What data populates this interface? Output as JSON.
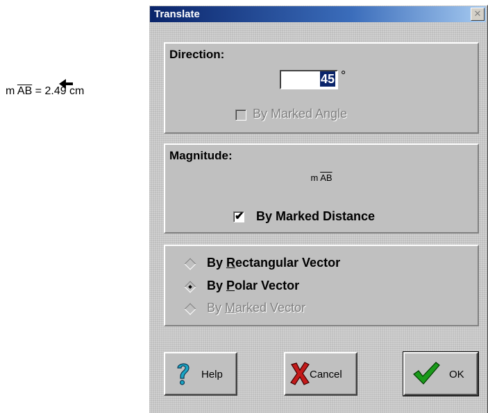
{
  "sketch": {
    "measure_prefix": "m ",
    "measure_segment": "AB",
    "measure_value": " = 2.49 cm"
  },
  "dialog": {
    "title": "Translate",
    "close_glyph": "✕"
  },
  "direction": {
    "label": "Direction:",
    "value": "45",
    "unit": "°",
    "by_marked_angle": {
      "label": "By Marked Angle",
      "checked": false,
      "enabled": false
    }
  },
  "magnitude": {
    "label": "Magnitude:",
    "formula_prefix": "m ",
    "formula_segment": "AB",
    "by_marked_distance": {
      "label": "By Marked Distance",
      "checked": true,
      "enabled": true,
      "mark": "✔"
    }
  },
  "vector_mode": {
    "options": [
      {
        "pre": "By ",
        "key": "R",
        "post": "ectangular Vector",
        "selected": false,
        "enabled": true
      },
      {
        "pre": "By ",
        "key": "P",
        "post": "olar Vector",
        "selected": true,
        "enabled": true
      },
      {
        "pre": "By ",
        "key": "M",
        "post": "arked Vector",
        "selected": false,
        "enabled": false
      }
    ]
  },
  "buttons": {
    "help": {
      "label": "Help",
      "icon": "question-mark-icon",
      "icon_color": "#1aa5c4"
    },
    "cancel": {
      "label": "Cancel",
      "icon": "red-x-icon",
      "icon_color": "#c41a1a"
    },
    "ok": {
      "label": "OK",
      "icon": "green-checkmark-icon",
      "icon_color": "#1a9a1a"
    }
  }
}
